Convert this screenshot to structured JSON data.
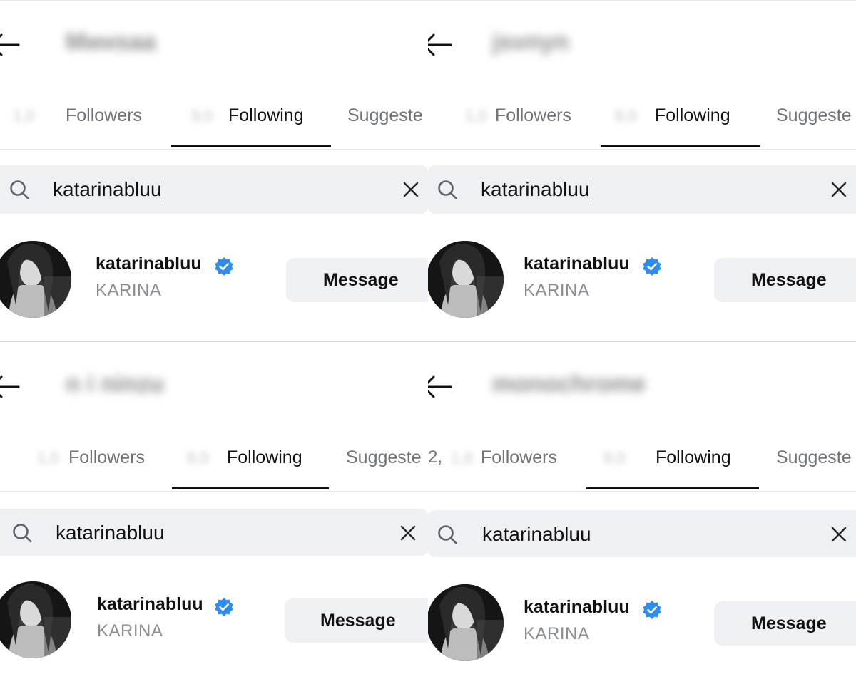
{
  "colors": {
    "verified": "#2d8cf0",
    "tab_active": "#111111",
    "tab_inactive": "#6e7279",
    "search_bg": "#eff0f3",
    "button_bg": "#eff0f3",
    "secondary_text": "#8a8d93"
  },
  "panels": [
    {
      "header": {
        "username": "Минsaa"
      },
      "tabs": {
        "followers_label": "Followers",
        "following_label": "Following",
        "suggested_label": "Suggeste",
        "active": "Following"
      },
      "search": {
        "value": "katarinabluu",
        "cursor_visible": true,
        "clear_icon": "close-icon",
        "search_icon": "search-icon"
      },
      "result": {
        "username": "katarinabluu",
        "full_name": "KARINA",
        "verified": true,
        "button_label": "Message"
      }
    },
    {
      "header": {
        "username": "jsvnyn"
      },
      "tabs": {
        "followers_label": "Followers",
        "following_label": "Following",
        "suggested_label": "Suggeste",
        "active": "Following"
      },
      "search": {
        "value": "katarinabluu",
        "cursor_visible": true,
        "clear_icon": "close-icon",
        "search_icon": "search-icon"
      },
      "result": {
        "username": "katarinabluu",
        "full_name": "KARINA",
        "verified": true,
        "button_label": "Message"
      }
    },
    {
      "header": {
        "username": "n i ninzu"
      },
      "tabs": {
        "followers_label": "Followers",
        "following_label": "Following",
        "suggested_label": "Suggeste",
        "active": "Following"
      },
      "search": {
        "value": "katarinabluu",
        "cursor_visible": false,
        "clear_icon": "close-icon",
        "search_icon": "search-icon"
      },
      "result": {
        "username": "katarinabluu",
        "full_name": "KARINA",
        "verified": true,
        "button_label": "Message"
      }
    },
    {
      "header": {
        "username": "monochrome"
      },
      "tabs": {
        "followers_label": "Followers",
        "following_label": "Following",
        "suggested_label": "Suggeste",
        "active": "Following",
        "prefix": "2,"
      },
      "search": {
        "value": "katarinabluu",
        "cursor_visible": false,
        "clear_icon": "close-icon",
        "search_icon": "search-icon"
      },
      "result": {
        "username": "katarinabluu",
        "full_name": "KARINA",
        "verified": true,
        "button_label": "Message"
      }
    }
  ]
}
